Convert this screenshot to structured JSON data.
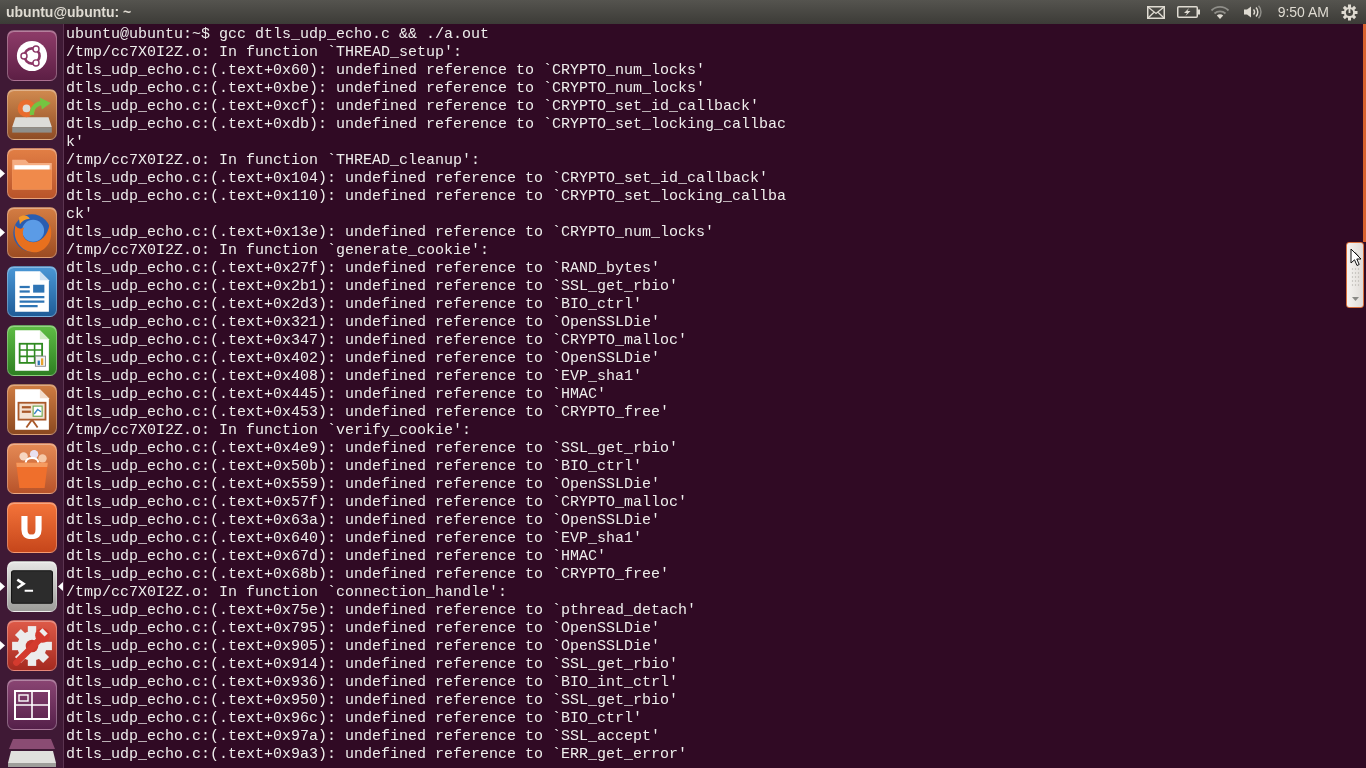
{
  "top_panel": {
    "window_title": "ubuntu@ubuntu: ~",
    "clock": "9:50 AM"
  },
  "launcher": [
    {
      "kind": "dash",
      "running": false,
      "focused": false
    },
    {
      "kind": "drive",
      "running": false,
      "focused": false
    },
    {
      "kind": "files",
      "running": true,
      "focused": false
    },
    {
      "kind": "browser",
      "running": true,
      "focused": false
    },
    {
      "kind": "writer",
      "running": false,
      "focused": false
    },
    {
      "kind": "calc",
      "running": false,
      "focused": false
    },
    {
      "kind": "impress",
      "running": false,
      "focused": false
    },
    {
      "kind": "software",
      "running": false,
      "focused": false
    },
    {
      "kind": "ubuntu_one",
      "glyph": "U",
      "running": false,
      "focused": false
    },
    {
      "kind": "terminal",
      "running": true,
      "focused": true
    },
    {
      "kind": "settings",
      "running": true,
      "focused": false
    },
    {
      "kind": "workspaces",
      "running": false,
      "focused": false
    },
    {
      "kind": "folded",
      "running": false,
      "focused": false
    }
  ],
  "terminal": {
    "lines": [
      "ubuntu@ubuntu:~$ gcc dtls_udp_echo.c && ./a.out",
      "/tmp/cc7X0I2Z.o: In function `THREAD_setup':",
      "dtls_udp_echo.c:(.text+0x60): undefined reference to `CRYPTO_num_locks'",
      "dtls_udp_echo.c:(.text+0xbe): undefined reference to `CRYPTO_num_locks'",
      "dtls_udp_echo.c:(.text+0xcf): undefined reference to `CRYPTO_set_id_callback'",
      "dtls_udp_echo.c:(.text+0xdb): undefined reference to `CRYPTO_set_locking_callbac",
      "k'",
      "/tmp/cc7X0I2Z.o: In function `THREAD_cleanup':",
      "dtls_udp_echo.c:(.text+0x104): undefined reference to `CRYPTO_set_id_callback'",
      "dtls_udp_echo.c:(.text+0x110): undefined reference to `CRYPTO_set_locking_callba",
      "ck'",
      "dtls_udp_echo.c:(.text+0x13e): undefined reference to `CRYPTO_num_locks'",
      "/tmp/cc7X0I2Z.o: In function `generate_cookie':",
      "dtls_udp_echo.c:(.text+0x27f): undefined reference to `RAND_bytes'",
      "dtls_udp_echo.c:(.text+0x2b1): undefined reference to `SSL_get_rbio'",
      "dtls_udp_echo.c:(.text+0x2d3): undefined reference to `BIO_ctrl'",
      "dtls_udp_echo.c:(.text+0x321): undefined reference to `OpenSSLDie'",
      "dtls_udp_echo.c:(.text+0x347): undefined reference to `CRYPTO_malloc'",
      "dtls_udp_echo.c:(.text+0x402): undefined reference to `OpenSSLDie'",
      "dtls_udp_echo.c:(.text+0x408): undefined reference to `EVP_sha1'",
      "dtls_udp_echo.c:(.text+0x445): undefined reference to `HMAC'",
      "dtls_udp_echo.c:(.text+0x453): undefined reference to `CRYPTO_free'",
      "/tmp/cc7X0I2Z.o: In function `verify_cookie':",
      "dtls_udp_echo.c:(.text+0x4e9): undefined reference to `SSL_get_rbio'",
      "dtls_udp_echo.c:(.text+0x50b): undefined reference to `BIO_ctrl'",
      "dtls_udp_echo.c:(.text+0x559): undefined reference to `OpenSSLDie'",
      "dtls_udp_echo.c:(.text+0x57f): undefined reference to `CRYPTO_malloc'",
      "dtls_udp_echo.c:(.text+0x63a): undefined reference to `OpenSSLDie'",
      "dtls_udp_echo.c:(.text+0x640): undefined reference to `EVP_sha1'",
      "dtls_udp_echo.c:(.text+0x67d): undefined reference to `HMAC'",
      "dtls_udp_echo.c:(.text+0x68b): undefined reference to `CRYPTO_free'",
      "/tmp/cc7X0I2Z.o: In function `connection_handle':",
      "dtls_udp_echo.c:(.text+0x75e): undefined reference to `pthread_detach'",
      "dtls_udp_echo.c:(.text+0x795): undefined reference to `OpenSSLDie'",
      "dtls_udp_echo.c:(.text+0x905): undefined reference to `OpenSSLDie'",
      "dtls_udp_echo.c:(.text+0x914): undefined reference to `SSL_get_rbio'",
      "dtls_udp_echo.c:(.text+0x936): undefined reference to `BIO_int_ctrl'",
      "dtls_udp_echo.c:(.text+0x950): undefined reference to `SSL_get_rbio'",
      "dtls_udp_echo.c:(.text+0x96c): undefined reference to `BIO_ctrl'",
      "dtls_udp_echo.c:(.text+0x97a): undefined reference to `SSL_accept'",
      "dtls_udp_echo.c:(.text+0x9a3): undefined reference to `ERR_get_error'"
    ]
  }
}
